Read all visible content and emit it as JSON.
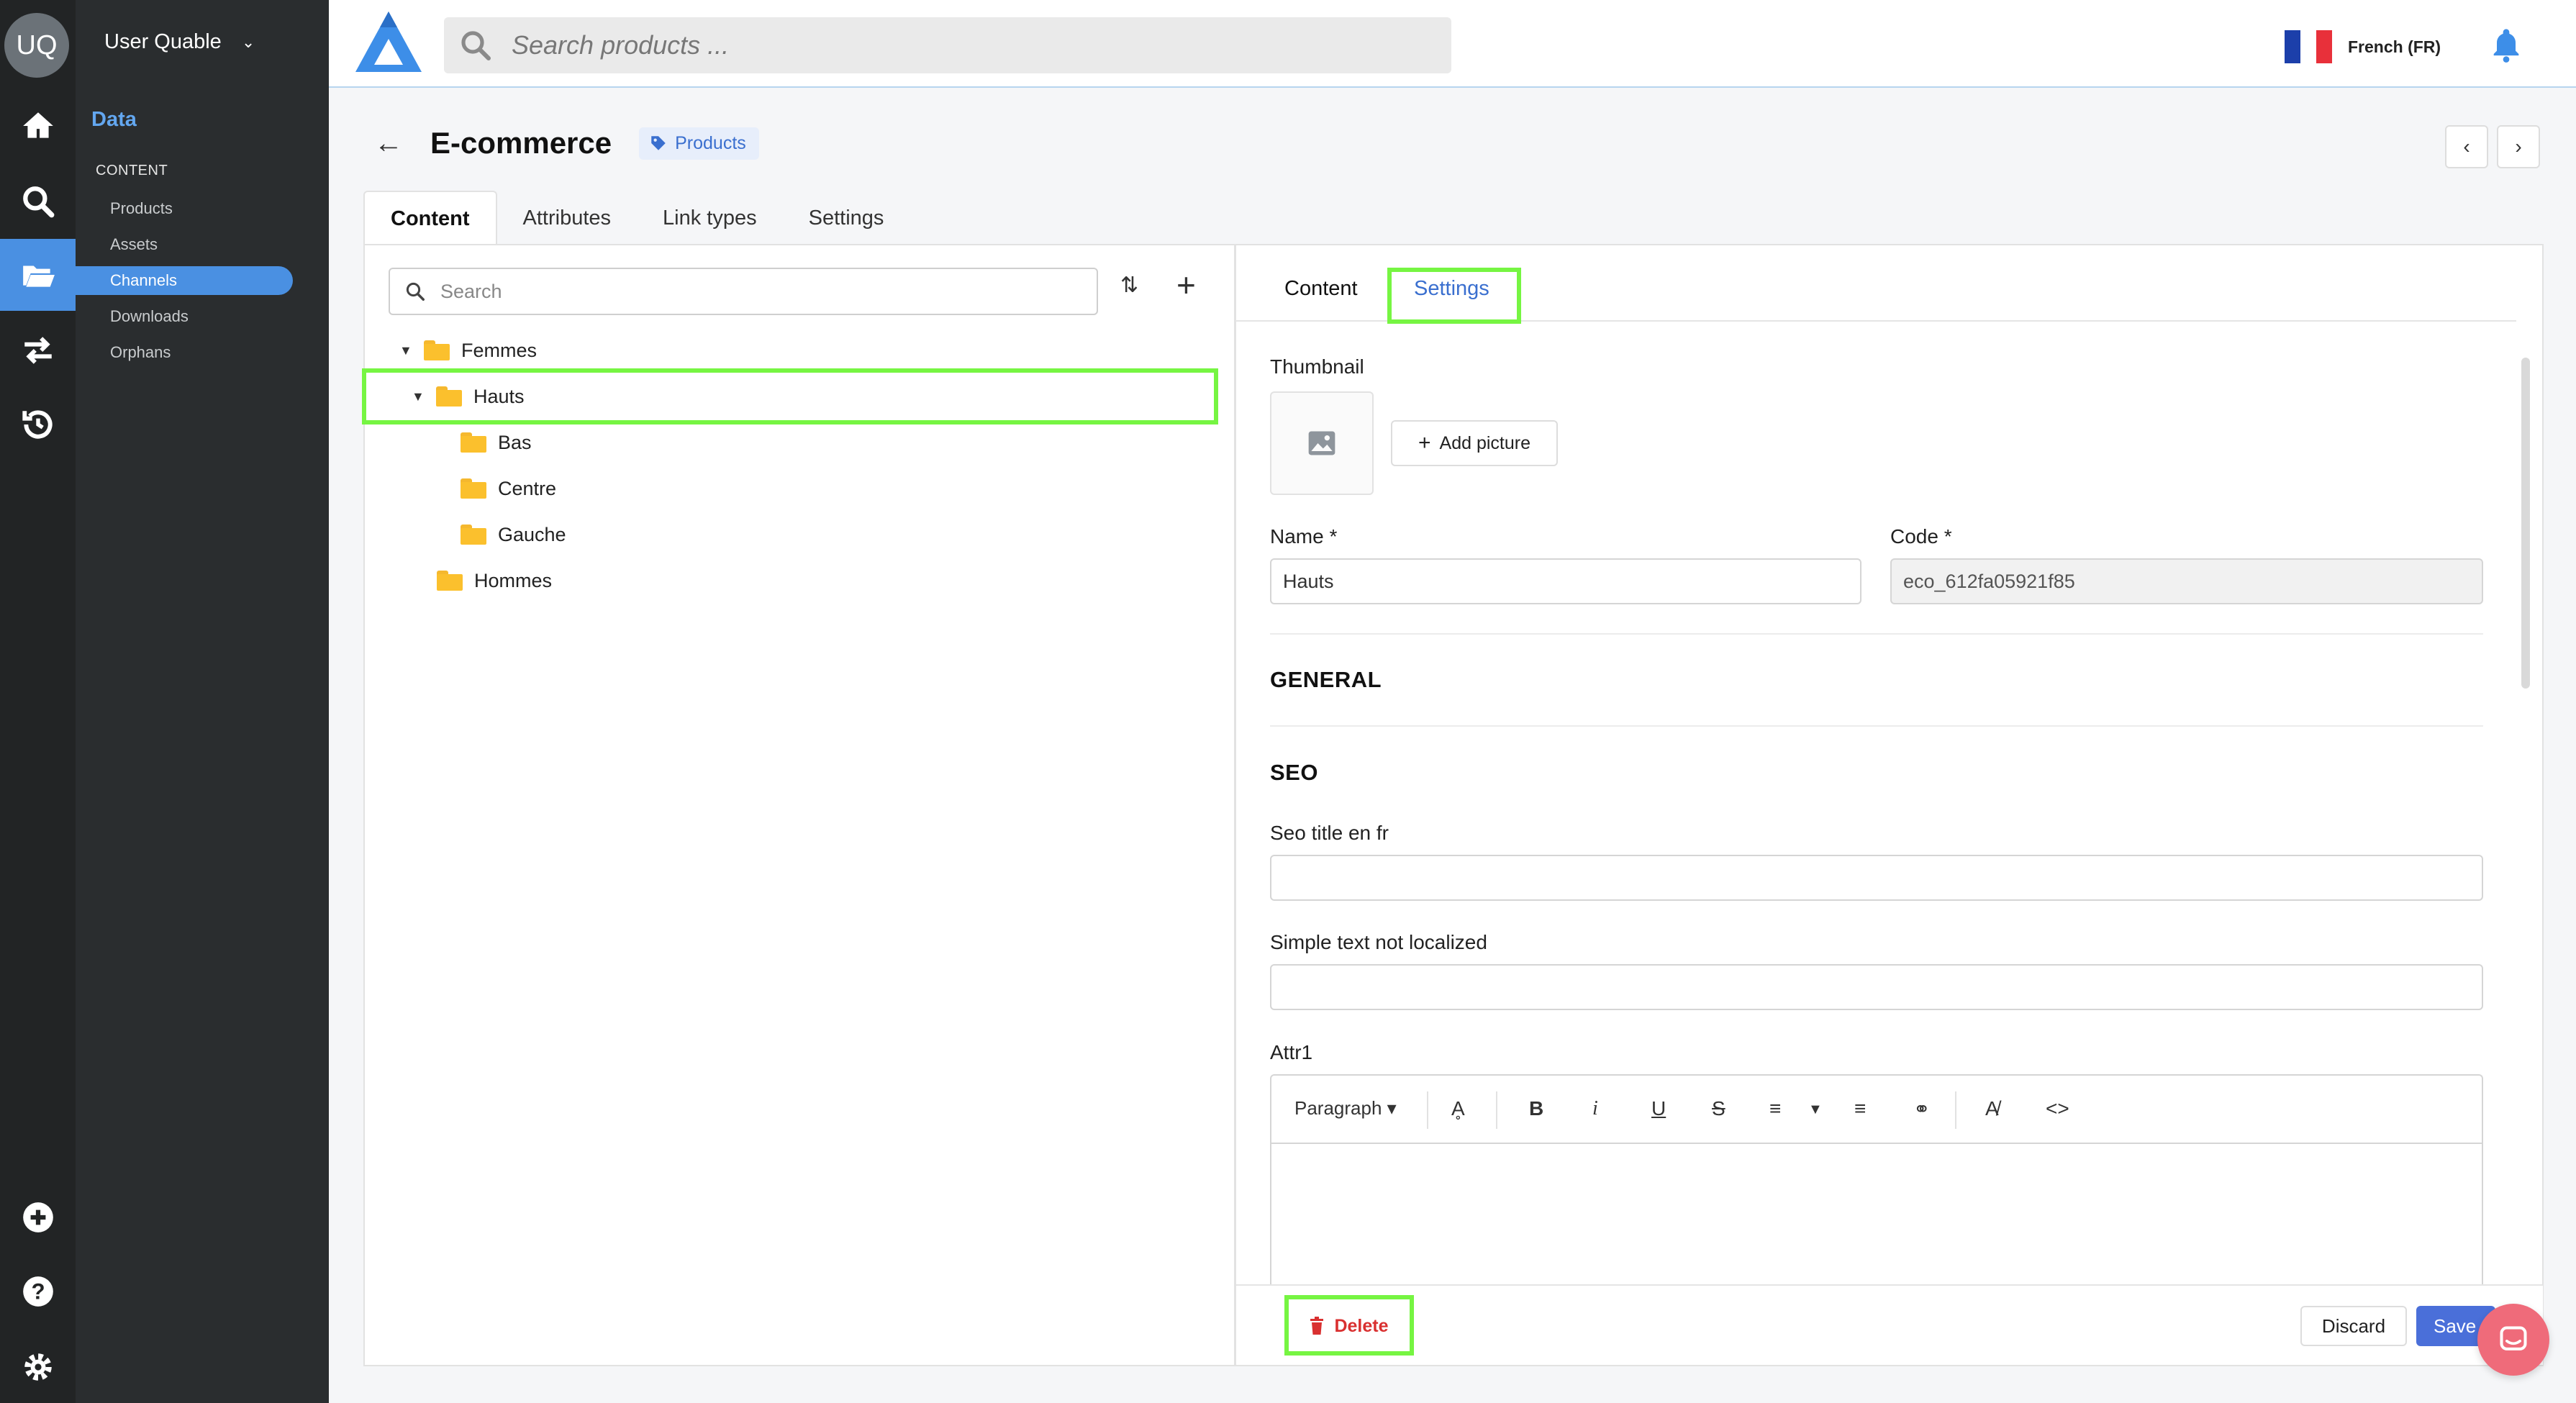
{
  "user": {
    "initials": "UQ",
    "name": "User Quable"
  },
  "nav": {
    "section": "Data",
    "group": "CONTENT",
    "items": [
      {
        "label": "Products"
      },
      {
        "label": "Assets"
      },
      {
        "label": "Channels",
        "active": true
      },
      {
        "label": "Downloads"
      },
      {
        "label": "Orphans"
      }
    ]
  },
  "search": {
    "placeholder": "Search products ..."
  },
  "language": {
    "label": "French (FR)",
    "flag_colors": [
      "#1c3faa",
      "#ffffff",
      "#e8303a"
    ]
  },
  "page": {
    "title": "E-commerce",
    "badge": "Products",
    "tabs": [
      "Content",
      "Attributes",
      "Link types",
      "Settings"
    ],
    "active_tab": "Content"
  },
  "tree": {
    "search_placeholder": "Search",
    "nodes": [
      {
        "label": "Femmes",
        "expanded": true,
        "level": 0
      },
      {
        "label": "Hauts",
        "expanded": true,
        "level": 1,
        "selected": true
      },
      {
        "label": "Bas",
        "level": 2
      },
      {
        "label": "Centre",
        "level": 2
      },
      {
        "label": "Gauche",
        "level": 2
      },
      {
        "label": "Hommes",
        "level": 0
      }
    ]
  },
  "detail": {
    "tabs": [
      "Content",
      "Settings"
    ],
    "active_tab": "Settings",
    "thumbnail_label": "Thumbnail",
    "add_picture": "Add picture",
    "name_label": "Name",
    "name_value": "Hauts",
    "code_label": "Code",
    "code_value": "eco_612fa05921f85",
    "required_mark": "*",
    "general_heading": "GENERAL",
    "seo_heading": "SEO",
    "seo_title_label": "Seo title en fr",
    "seo_title_value": "",
    "simple_text_label": "Simple text not localized",
    "simple_text_value": "",
    "attr1_label": "Attr1",
    "editor_paragraph": "Paragraph"
  },
  "footer": {
    "delete": "Delete",
    "discard": "Discard",
    "save": "Save"
  },
  "colors": {
    "accent": "#4a90e2",
    "highlight": "#76f542",
    "danger": "#d93030",
    "save": "#4a6fd9"
  }
}
